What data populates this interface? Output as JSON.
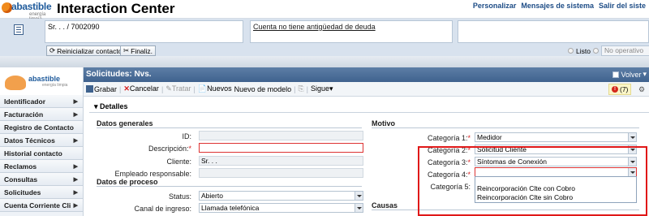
{
  "header": {
    "logo_name": "abastible",
    "logo_tagline": "energía limpia",
    "app_title": "Interaction Center",
    "links": [
      "Personalizar",
      "Mensajes de sistema",
      "Salir del siste"
    ]
  },
  "context": {
    "customer": "Sr. . . / 7002090",
    "debt_notice": "Cuenta no tiene antigüedad de deuda",
    "buttons": [
      "Reinicializar contacto",
      "Finaliz."
    ],
    "status_ready": "Listo",
    "status_not_operational": "No operativo"
  },
  "sidebar": {
    "logo_name": "abastible",
    "logo_tagline": "energía limpia",
    "items": [
      {
        "label": "Identificador",
        "arrow": true
      },
      {
        "label": "Facturación",
        "arrow": true
      },
      {
        "label": "Registro de Contacto",
        "arrow": false
      },
      {
        "label": "Datos Técnicos",
        "arrow": true
      },
      {
        "label": "Historial contacto",
        "arrow": false
      },
      {
        "label": "Reclamos",
        "arrow": true
      },
      {
        "label": "Consultas",
        "arrow": true
      },
      {
        "label": "Solicitudes",
        "arrow": true
      },
      {
        "label": "Cuenta Corriente Cli",
        "arrow": true
      }
    ]
  },
  "page": {
    "title": "Solicitudes: Nvs.",
    "back": "Volver",
    "toolbar": {
      "save": "Grabar",
      "cancel": "Cancelar",
      "process": "Tratar",
      "new": "Nuevos",
      "new_from_template": "Nuevo de modelo",
      "next": "Sigue"
    },
    "alert_count": "(7)",
    "details_label": "Detalles"
  },
  "general": {
    "section": "Datos generales",
    "id_label": "ID:",
    "desc_label": "Descripción:",
    "client_label": "Cliente:",
    "client_value": "Sr. . .",
    "employee_label": "Empleado responsable:"
  },
  "process": {
    "section": "Datos de proceso",
    "status_label": "Status:",
    "status_value": "Abierto",
    "channel_label": "Canal de ingreso:",
    "channel_value": "Llamada telefónica"
  },
  "motive": {
    "section": "Motivo",
    "cat1_label": "Categoría 1:",
    "cat1_value": "Medidor",
    "cat2_label": "Categoría 2:",
    "cat2_value": "Solicitud Cliente",
    "cat3_label": "Categoría 3:",
    "cat3_value": "Síntomas de Conexión",
    "cat4_label": "Categoría 4:",
    "cat5_label": "Categoría 5:",
    "options": [
      "Reincorporación Clte con Cobro",
      "Reincorporación Clte sin Cobro"
    ],
    "causes_label": "Causas"
  },
  "colors": {
    "accent": "#3f628e",
    "highlight": "#e01818",
    "required": "#d62020"
  }
}
